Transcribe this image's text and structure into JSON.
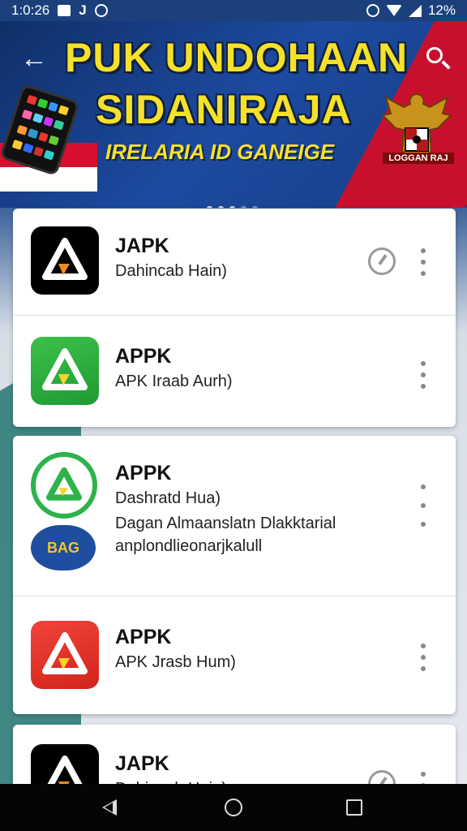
{
  "status_bar": {
    "time": "1:0:26",
    "j_icon": "J",
    "battery": "12%",
    "icons": [
      "notification-square-icon",
      "sync-icon",
      "alarm-icon",
      "wifi-icon",
      "signal-icon"
    ]
  },
  "header": {
    "back_icon": "←",
    "title_line1": "PUK UNDOHAAN",
    "title_line2": "SIDANIRAJA",
    "subtitle": "IRELARIA ID GANEIGE",
    "emblem_label": "LOGGAN RAJ",
    "carousel_dots": 5,
    "carousel_active": 2
  },
  "colors": {
    "title_yellow": "#f6e12a",
    "banner_blue": "#1d4aa0",
    "flag_red": "#c8102e"
  },
  "apps": [
    {
      "name": "JAPK",
      "subtitle": "Dahincab Hain)",
      "icon": "black-triangle-logo-icon",
      "has_download": true
    },
    {
      "name": "APPK",
      "subtitle": "APK Iraab Aurh)",
      "icon": "green-triangle-logo-icon",
      "has_download": false
    },
    {
      "name": "APPK",
      "subtitle": "Dashratd Hua)",
      "description": "Dagan Almaanslatn Dlakktarial anplondlieonarjkalull",
      "icon": "green-circle-logo-icon",
      "badge": "BAG",
      "has_download": false
    },
    {
      "name": "APPK",
      "subtitle": "APK Jrasb Hum)",
      "icon": "red-triangle-logo-icon",
      "has_download": false
    },
    {
      "name": "JAPK",
      "subtitle": "Dahincab Hain)",
      "icon": "black-triangle-logo-icon",
      "has_download": true
    }
  ],
  "navbar": {
    "icons": [
      "back-triangle-icon",
      "home-circle-icon",
      "recent-square-icon"
    ]
  }
}
